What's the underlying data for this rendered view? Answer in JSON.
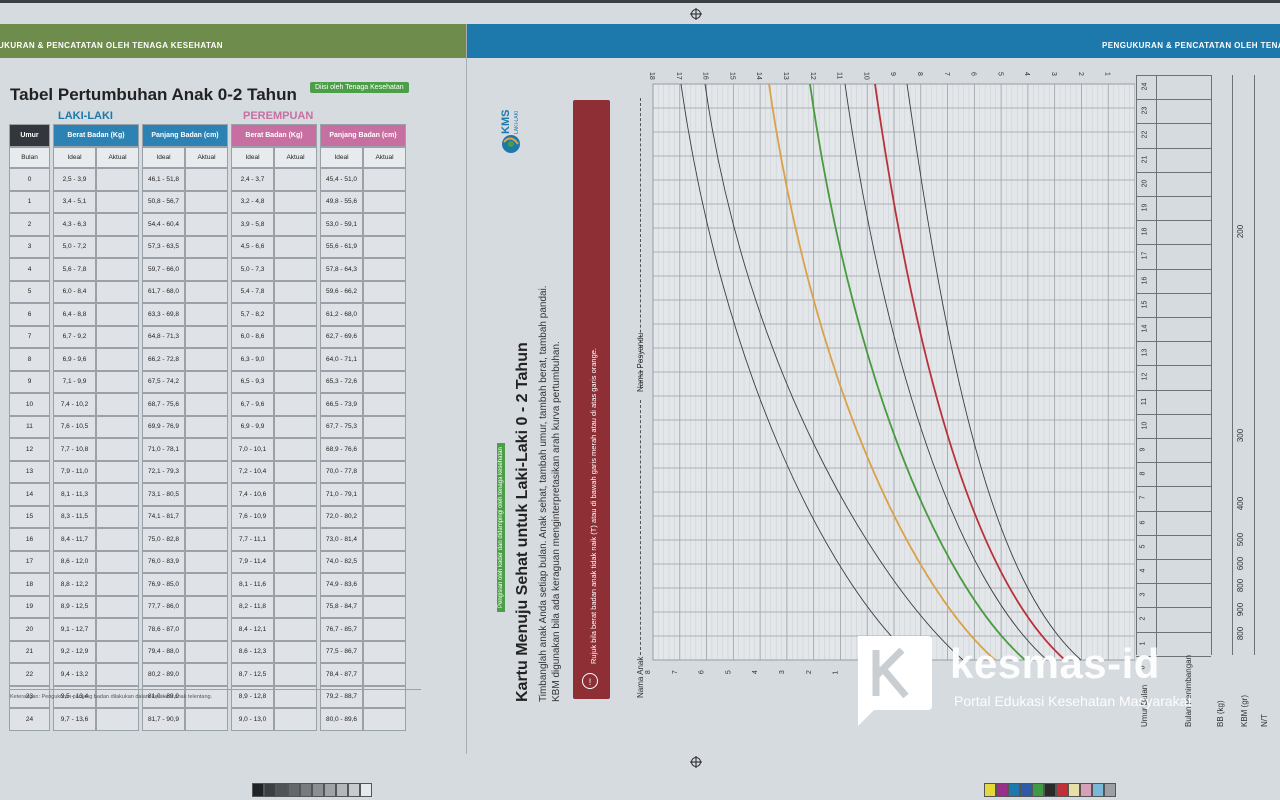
{
  "banners": {
    "left": "UKURAN & PENCATATAN OLEH TENAGA KESEHATAN",
    "right": "PENGUKURAN & PENCATATAN OLEH TENA"
  },
  "table_page": {
    "title": "Tabel Pertumbuhan Anak 0-2 Tahun",
    "badge": "Diisi oleh Tenaga Kesehatan",
    "boys_label": "LAKI-LAKI",
    "girls_label": "PEREMPUAN",
    "headers": {
      "age": "Umur",
      "age_unit": "Bulan",
      "weight": "Berat Badan (Kg)",
      "length": "Panjang Badan (cm)",
      "ideal": "Ideal",
      "actual": "Aktual"
    },
    "rows": [
      {
        "age": "0",
        "bw": "2,5 - 3,9",
        "bl": "46,1 - 51,8",
        "gw": "2,4 - 3,7",
        "gl": "45,4 - 51,0"
      },
      {
        "age": "1",
        "bw": "3,4 - 5,1",
        "bl": "50,8 - 56,7",
        "gw": "3,2 - 4,8",
        "gl": "49,8 - 55,6"
      },
      {
        "age": "2",
        "bw": "4,3 - 6,3",
        "bl": "54,4 - 60,4",
        "gw": "3,9 - 5,8",
        "gl": "53,0 - 59,1"
      },
      {
        "age": "3",
        "bw": "5,0 - 7,2",
        "bl": "57,3 - 63,5",
        "gw": "4,5 - 6,6",
        "gl": "55,6 - 61,9"
      },
      {
        "age": "4",
        "bw": "5,6 - 7,8",
        "bl": "59,7 - 66,0",
        "gw": "5,0 - 7,3",
        "gl": "57,8 - 64,3"
      },
      {
        "age": "5",
        "bw": "6,0 - 8,4",
        "bl": "61,7 - 68,0",
        "gw": "5,4 - 7,8",
        "gl": "59,6 - 66,2"
      },
      {
        "age": "6",
        "bw": "6,4 - 8,8",
        "bl": "63,3 - 69,8",
        "gw": "5,7 - 8,2",
        "gl": "61,2 - 68,0"
      },
      {
        "age": "7",
        "bw": "6,7 - 9,2",
        "bl": "64,8 - 71,3",
        "gw": "6,0 - 8,6",
        "gl": "62,7 - 69,6"
      },
      {
        "age": "8",
        "bw": "6,9 - 9,6",
        "bl": "66,2 - 72,8",
        "gw": "6,3 - 9,0",
        "gl": "64,0 - 71,1"
      },
      {
        "age": "9",
        "bw": "7,1 - 9,9",
        "bl": "67,5 - 74,2",
        "gw": "6,5 - 9,3",
        "gl": "65,3 - 72,6"
      },
      {
        "age": "10",
        "bw": "7,4 - 10,2",
        "bl": "68,7 - 75,6",
        "gw": "6,7 - 9,6",
        "gl": "66,5 - 73,9"
      },
      {
        "age": "11",
        "bw": "7,6 - 10,5",
        "bl": "69,9 - 76,9",
        "gw": "6,9 - 9,9",
        "gl": "67,7 - 75,3"
      },
      {
        "age": "12",
        "bw": "7,7 - 10,8",
        "bl": "71,0 - 78,1",
        "gw": "7,0 - 10,1",
        "gl": "68,9 - 76,6"
      },
      {
        "age": "13",
        "bw": "7,9 - 11,0",
        "bl": "72,1 - 79,3",
        "gw": "7,2 - 10,4",
        "gl": "70,0 - 77,8"
      },
      {
        "age": "14",
        "bw": "8,1 - 11,3",
        "bl": "73,1 - 80,5",
        "gw": "7,4 - 10,6",
        "gl": "71,0 - 79,1"
      },
      {
        "age": "15",
        "bw": "8,3 - 11,5",
        "bl": "74,1 - 81,7",
        "gw": "7,6 - 10,9",
        "gl": "72,0 - 80,2"
      },
      {
        "age": "16",
        "bw": "8,4 - 11,7",
        "bl": "75,0 - 82,8",
        "gw": "7,7 - 11,1",
        "gl": "73,0 - 81,4"
      },
      {
        "age": "17",
        "bw": "8,6 - 12,0",
        "bl": "76,0 - 83,9",
        "gw": "7,9 - 11,4",
        "gl": "74,0 - 82,5"
      },
      {
        "age": "18",
        "bw": "8,8 - 12,2",
        "bl": "76,9 - 85,0",
        "gw": "8,1 - 11,6",
        "gl": "74,9 - 83,6"
      },
      {
        "age": "19",
        "bw": "8,9 - 12,5",
        "bl": "77,7 - 86,0",
        "gw": "8,2 - 11,8",
        "gl": "75,8 - 84,7"
      },
      {
        "age": "20",
        "bw": "9,1 - 12,7",
        "bl": "78,6 - 87,0",
        "gw": "8,4 - 12,1",
        "gl": "76,7 - 85,7"
      },
      {
        "age": "21",
        "bw": "9,2 - 12,9",
        "bl": "79,4 - 88,0",
        "gw": "8,6 - 12,3",
        "gl": "77,5 - 86,7"
      },
      {
        "age": "22",
        "bw": "9,4 - 13,2",
        "bl": "80,2 - 89,0",
        "gw": "8,7 - 12,5",
        "gl": "78,4 - 87,7"
      },
      {
        "age": "23",
        "bw": "9,5 - 13,4",
        "bl": "81,0 - 89,9",
        "gw": "8,9 - 12,8",
        "gl": "79,2 - 88,7"
      },
      {
        "age": "24",
        "bw": "9,7 - 13,6",
        "bl": "81,7 - 90,9",
        "gw": "9,0 - 13,0",
        "gl": "80,0 - 89,6"
      }
    ],
    "footnote": "Keterangan: Pengukuran panjang badan dilakukan dalam keadaan anak telentang."
  },
  "kms_page": {
    "logo_text": "KMS",
    "logo_sub": "LAKI-LAKI",
    "tag": "Pengisian oleh kader dan didampingi oleh tenaga kesehatan",
    "title": "Kartu Menuju Sehat untuk Laki-Laki 0 - 2 Tahun",
    "desc1": "Timbanglah anak Anda setiap bulan. Anak sehat, tambah umur, tambah berat, tambah pandai.",
    "desc2": "KBM digunakan bila ada keraguan menginterpretasikan arah kurva pertumbuhan.",
    "red_note": "Rujuk bila berat badan anak tidak naik (T) atau di bawah garis merah atau di atas garis orange.",
    "warn_icon": "!",
    "posyandu_label": "Nama Posyandu",
    "anak_label": "Nama Anak",
    "weight_scale": [
      "18",
      "17",
      "16",
      "15",
      "14",
      "13",
      "12",
      "11",
      "10",
      "9",
      "8",
      "7",
      "6",
      "5",
      "4",
      "3",
      "2",
      "1"
    ],
    "bottom_scale": [
      "18",
      "17",
      "16",
      "15",
      "14",
      "13",
      "12",
      "11",
      "10",
      "9",
      "8",
      "7",
      "6",
      "5",
      "4",
      "3",
      "2",
      "1"
    ],
    "months": [
      "24",
      "23",
      "22",
      "21",
      "20",
      "19",
      "18",
      "17",
      "16",
      "15",
      "14",
      "13",
      "12",
      "11",
      "10",
      "9",
      "8",
      "7",
      "6",
      "5",
      "4",
      "3",
      "2",
      "1",
      "0"
    ],
    "side_headers": [
      "Umur Bulan",
      "Bulan Penimbangan",
      "BB (kg)",
      "KBM (gr)",
      "N/T"
    ],
    "kbm_values": [
      "200",
      "300",
      "400",
      "500",
      "600",
      "800",
      "900",
      "800"
    ],
    "colors": {
      "red": "#b8323a",
      "green": "#4a9a42",
      "orange": "#d9a24a",
      "black": "#3a3f44"
    }
  },
  "watermark": {
    "title": "kesmas-id",
    "subtitle": "Portal Edukasi Kesehatan Masyarakat"
  },
  "color_bars": {
    "gray": [
      "#1f2326",
      "#3a3f44",
      "#4e5358",
      "#62676c",
      "#767b80",
      "#8a8f94",
      "#9ea3a8",
      "#b2b7bc",
      "#c6cbd0",
      "#e6e9ec"
    ],
    "color": [
      "#e6d83a",
      "#9a2f8a",
      "#1d78ab",
      "#2e5aa8",
      "#3f9a44",
      "#2a2a2a",
      "#c03038",
      "#e6e0a8",
      "#d8a0b8",
      "#7ab8d8",
      "#9aa0a6"
    ]
  }
}
